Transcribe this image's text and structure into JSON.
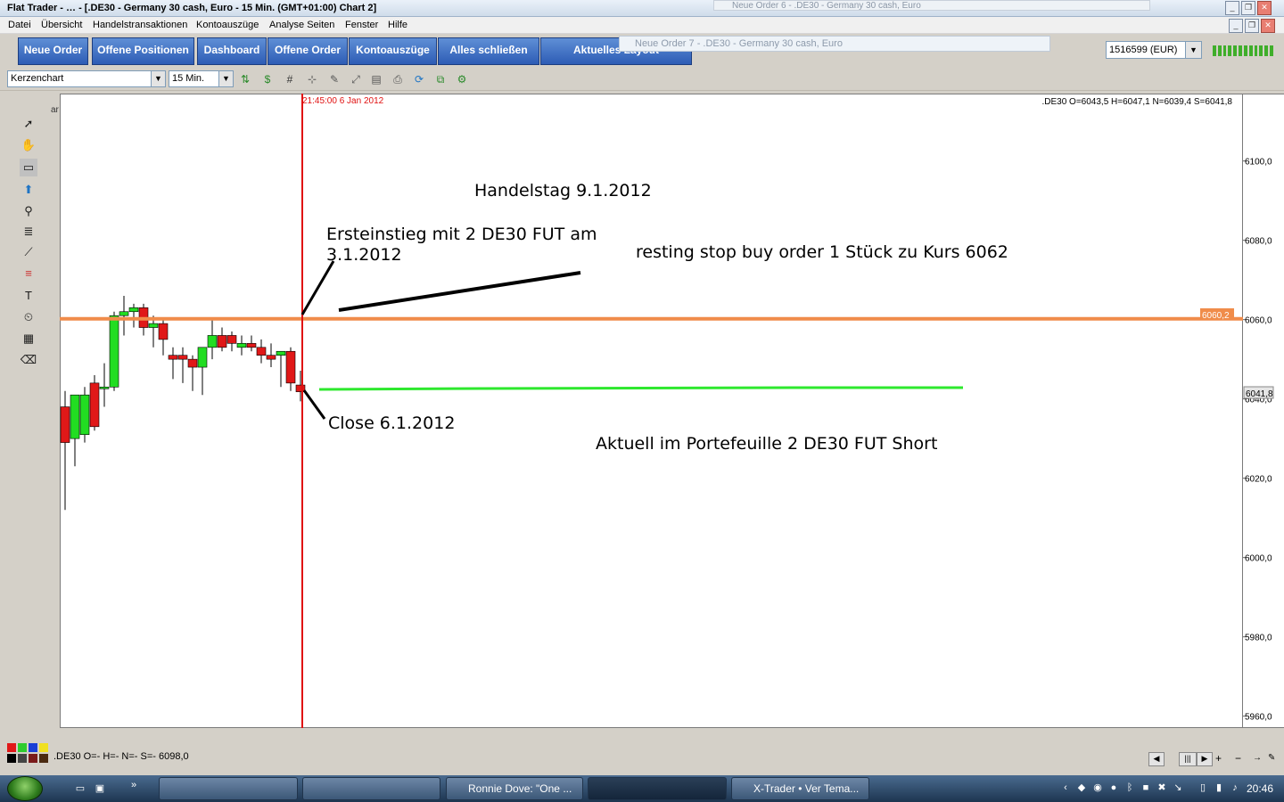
{
  "window": {
    "title": "Flat Trader - … - [.DE30 - Germany 30 cash, Euro - 15 Min. (GMT+01:00)   Chart 2]",
    "ghost_order6": "Neue Order 6 - .DE30 - Germany 30 cash, Euro",
    "ghost_order7": "Neue Order 7 - .DE30 - Germany 30 cash, Euro"
  },
  "menu": [
    "Datei",
    "Übersicht",
    "Handelstransaktionen",
    "Kontoauszüge",
    "Analyse Seiten",
    "Fenster",
    "Hilfe"
  ],
  "toolbar": {
    "buttons": [
      "Neue Order",
      "Offene Positionen",
      "Dashboard",
      "Offene Order",
      "Kontoauszüge",
      "Alles schließen",
      "Aktuelles Layout"
    ],
    "account": "1516599 (EUR)"
  },
  "chart_toolbar": {
    "chart_type": "Kerzenchart",
    "timeframe": "15 Min."
  },
  "chart": {
    "info": ".DE30 O=6043,5 H=6047,1 N=6039,4 S=6041,8",
    "cursor_time": "21:45:00 6 Jan 2012",
    "orange_line_label": "6060,2",
    "current_price_label": "6041,8",
    "y_ticks": [
      "6100,0",
      "6080,0",
      "6060,0",
      "6040,0",
      "6020,0",
      "6000,0",
      "5980,0",
      "5960,0"
    ],
    "annotations": {
      "day": "Handelstag 9.1.2012",
      "entry": "Ersteinstieg mit 2 DE30 FUT am",
      "entry2": "3.1.2012",
      "resting": "resting stop buy order 1 Stück zu Kurs 6062",
      "close": "Close 6.1.2012",
      "portfolio": "Aktuell im Portefeuille 2 DE30 FUT Short"
    }
  },
  "chart_data": {
    "type": "candlestick",
    "symbol": ".DE30",
    "ylim": [
      5957,
      6117
    ],
    "ohlc": [
      [
        6038,
        6042,
        6012,
        6029
      ],
      [
        6030,
        6041,
        6023,
        6041
      ],
      [
        6031,
        6043,
        6029,
        6041
      ],
      [
        6044,
        6046,
        6032,
        6033
      ],
      [
        6043,
        6049,
        6038,
        6043
      ],
      [
        6043,
        6062,
        6042,
        6061
      ],
      [
        6061,
        6066,
        6056,
        6062
      ],
      [
        6062,
        6064,
        6058,
        6063
      ],
      [
        6063,
        6064,
        6056,
        6058
      ],
      [
        6058,
        6061,
        6053,
        6059
      ],
      [
        6059,
        6060,
        6051,
        6055
      ],
      [
        6051,
        6053,
        6045,
        6050
      ],
      [
        6051,
        6053,
        6044,
        6050
      ],
      [
        6050,
        6051,
        6042,
        6048
      ],
      [
        6048,
        6053,
        6041,
        6053
      ],
      [
        6053,
        6060,
        6050,
        6056
      ],
      [
        6056,
        6058,
        6052,
        6053
      ],
      [
        6056,
        6057,
        6052,
        6054
      ],
      [
        6053,
        6056,
        6051,
        6054
      ],
      [
        6054,
        6056,
        6052,
        6053
      ],
      [
        6053,
        6055,
        6049,
        6051
      ],
      [
        6051,
        6054,
        6048,
        6050
      ],
      [
        6051,
        6052,
        6043,
        6052
      ],
      [
        6052,
        6053,
        6042,
        6044
      ],
      [
        6043.5,
        6047.1,
        6039.4,
        6041.8
      ]
    ],
    "horizontal_lines": [
      {
        "price": 6060.2,
        "color": "#f08c4a"
      },
      {
        "price": 6041.8,
        "color": "#2ee82e"
      }
    ]
  },
  "status": {
    "text": ".DE30 O=- H=- N=- S=-   6098,0"
  },
  "taskbar": {
    "tasks": [
      "Ronnie Dove: \"One ...",
      "X-Trader • Ver Tema..."
    ],
    "clock": "20:46"
  },
  "colors": {
    "button": "#2d5cb5",
    "candle_up": "#22dd22",
    "candle_down": "#e01818",
    "cursor": "#e01010"
  }
}
